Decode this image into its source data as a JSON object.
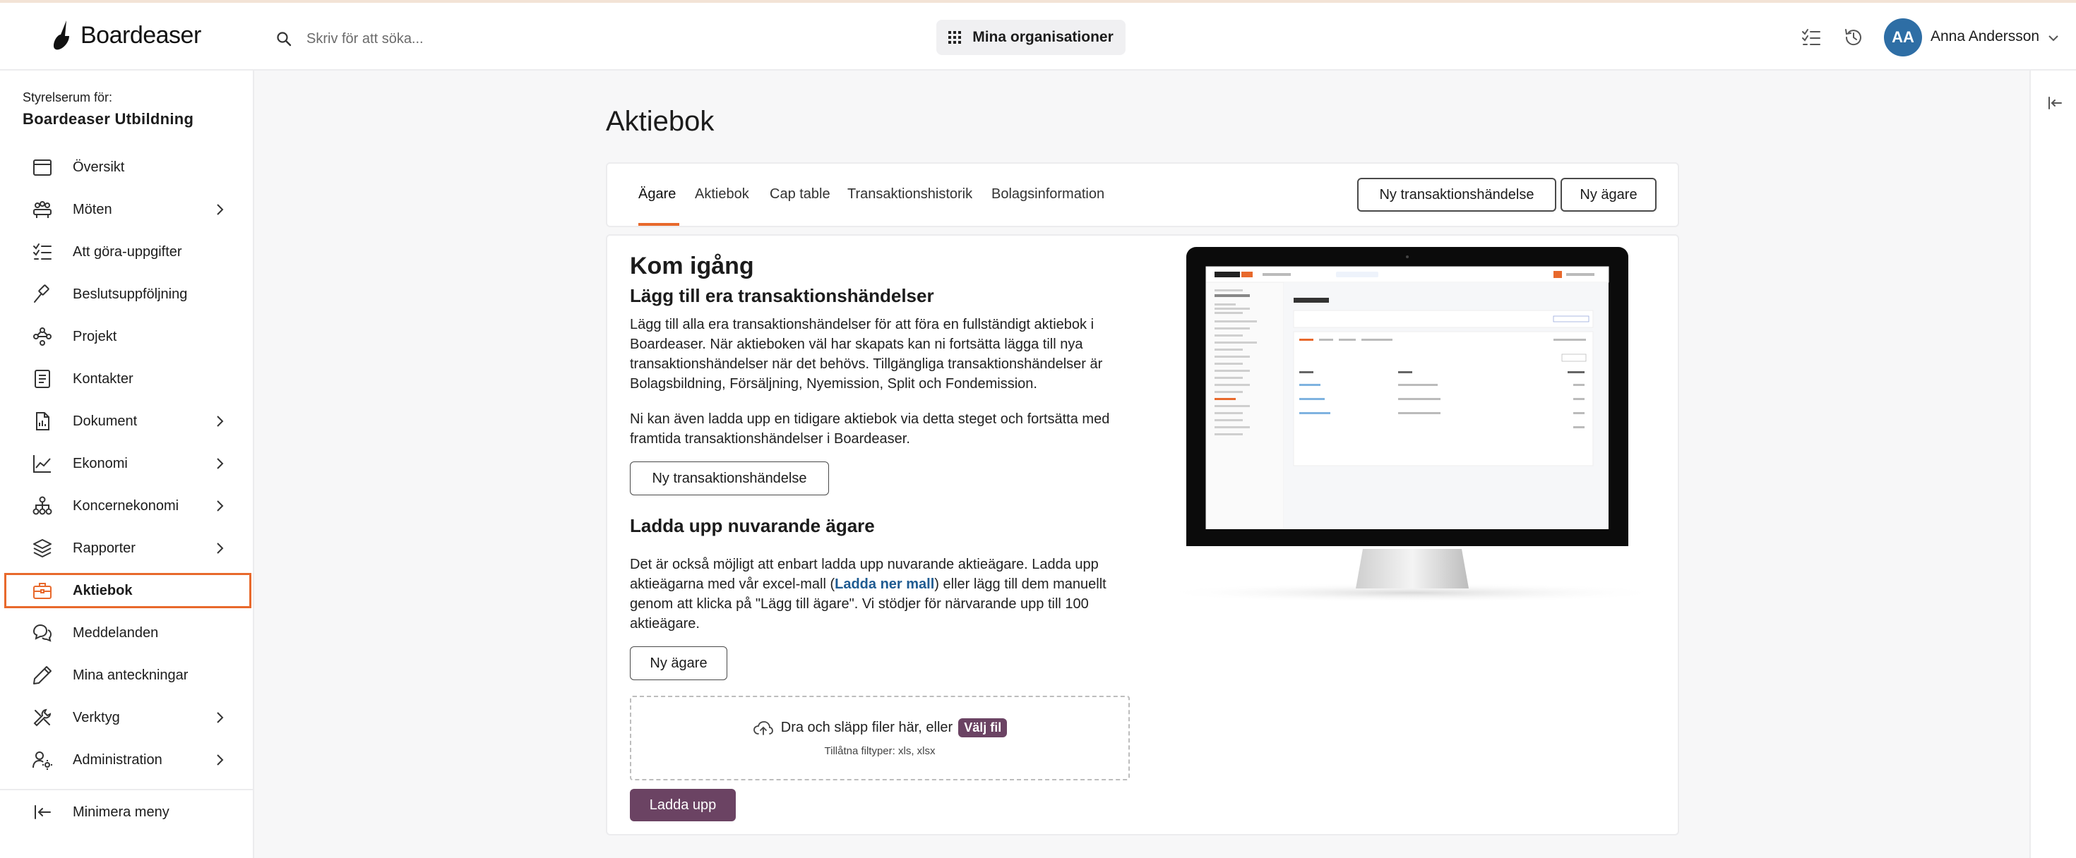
{
  "header": {
    "logo_text": "Boardeaser",
    "search_placeholder": "Skriv för att söka...",
    "org_button_label": "Mina organisationer",
    "user_initials": "AA",
    "user_name": "Anna Andersson"
  },
  "sidebar": {
    "subtitle": "Styrelserum för:",
    "org_name": "Boardeaser Utbildning",
    "items": [
      {
        "label": "Översikt",
        "icon": "calendar-icon",
        "chevron": false
      },
      {
        "label": "Möten",
        "icon": "meeting-icon",
        "chevron": true
      },
      {
        "label": "Att göra-uppgifter",
        "icon": "checklist-icon",
        "chevron": false
      },
      {
        "label": "Beslutsuppföljning",
        "icon": "gavel-icon",
        "chevron": false
      },
      {
        "label": "Projekt",
        "icon": "project-icon",
        "chevron": false
      },
      {
        "label": "Kontakter",
        "icon": "contacts-icon",
        "chevron": false
      },
      {
        "label": "Dokument",
        "icon": "document-icon",
        "chevron": true
      },
      {
        "label": "Ekonomi",
        "icon": "chart-line-icon",
        "chevron": true
      },
      {
        "label": "Koncernekonomi",
        "icon": "hierarchy-icon",
        "chevron": true
      },
      {
        "label": "Rapporter",
        "icon": "layers-icon",
        "chevron": true
      },
      {
        "label": "Aktiebok",
        "icon": "briefcase-icon",
        "chevron": false,
        "active": true
      },
      {
        "label": "Meddelanden",
        "icon": "messages-icon",
        "chevron": false
      },
      {
        "label": "Mina anteckningar",
        "icon": "pencil-icon",
        "chevron": false
      },
      {
        "label": "Verktyg",
        "icon": "tools-icon",
        "chevron": true
      },
      {
        "label": "Administration",
        "icon": "admin-icon",
        "chevron": true
      }
    ],
    "minimize_label": "Minimera meny"
  },
  "main": {
    "title": "Aktiebok",
    "tabs": [
      {
        "label": "Ägare",
        "active": true
      },
      {
        "label": "Aktiebok"
      },
      {
        "label": "Cap table"
      },
      {
        "label": "Transaktionshistorik"
      },
      {
        "label": "Bolagsinformation"
      }
    ],
    "btn_new_transaction": "Ny transaktionshändelse",
    "btn_new_owner": "Ny ägare",
    "get_started": "Kom igång",
    "section1_title": "Lägg till era transaktionshändelser",
    "section1_p1": "Lägg till alla era transaktionshändelser för att föra en fullständigt aktiebok i Boardeaser. När aktieboken väl har skapats kan ni fortsätta lägga till nya transaktionshändelser när det behövs. Tillgängliga transaktionshändelser är Bolagsbildning, Försäljning, Nyemission, Split och Fondemission.",
    "section1_p2": "Ni kan även ladda upp en tidigare aktiebok via detta steget och fortsätta med framtida transaktionshändelser i Boardeaser.",
    "section1_button": "Ny transaktionshändelse",
    "section2_title": "Ladda upp nuvarande ägare",
    "section2_p_before": "Det är också möjligt att enbart ladda upp nuvarande aktieägare. Ladda upp aktieägarna med vår excel-mall (",
    "section2_link": "Ladda ner mall",
    "section2_p_after": ") eller lägg till dem manuellt genom att klicka på \"Lägg till ägare\". Vi stödjer för närvarande upp till 100 aktieägare.",
    "section2_button": "Ny ägare",
    "dropzone_text": "Dra och släpp filer här, eller",
    "dropzone_pick": "Välj fil",
    "dropzone_types": "Tillåtna filtyper: xls, xlsx",
    "upload_button": "Ladda upp"
  },
  "colors": {
    "accent_orange": "#e8692c",
    "brand_purple": "#6b4363",
    "avatar_blue": "#2e6ea5",
    "link_blue": "#1f5b91"
  }
}
